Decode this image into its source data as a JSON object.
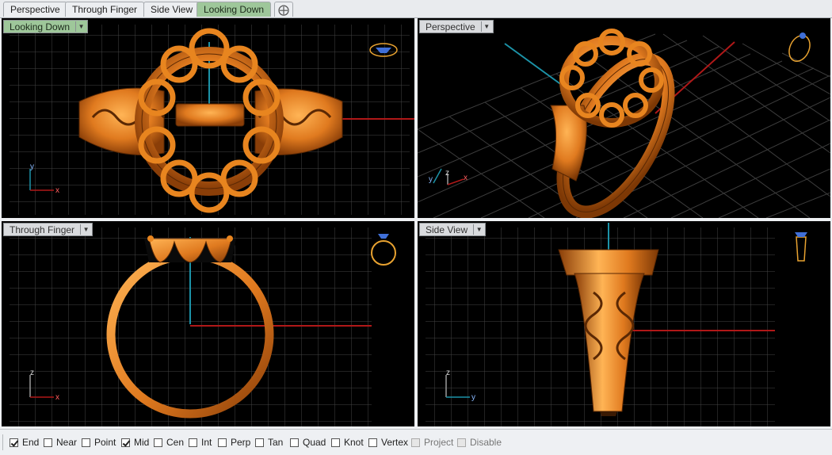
{
  "tabs": [
    {
      "label": "Perspective",
      "active": false
    },
    {
      "label": "Through Finger",
      "active": false
    },
    {
      "label": "Side View",
      "active": false
    },
    {
      "label": "Looking Down",
      "active": true
    }
  ],
  "viewports": {
    "looking_down": {
      "label": "Looking Down",
      "active": true
    },
    "perspective": {
      "label": "Perspective",
      "active": false
    },
    "through_finger": {
      "label": "Through Finger",
      "active": false
    },
    "side_view": {
      "label": "Side View",
      "active": false
    }
  },
  "axes": {
    "x": "x",
    "y": "y",
    "z": "z"
  },
  "osnaps": [
    {
      "label": "End",
      "checked": true,
      "enabled": true
    },
    {
      "label": "Near",
      "checked": false,
      "enabled": true
    },
    {
      "label": "Point",
      "checked": false,
      "enabled": true
    },
    {
      "label": "Mid",
      "checked": true,
      "enabled": true
    },
    {
      "label": "Cen",
      "checked": false,
      "enabled": true
    },
    {
      "label": "Int",
      "checked": false,
      "enabled": true
    },
    {
      "label": "Perp",
      "checked": false,
      "enabled": true
    },
    {
      "label": "Tan",
      "checked": false,
      "enabled": true
    },
    {
      "label": "Quad",
      "checked": false,
      "enabled": true
    },
    {
      "label": "Knot",
      "checked": false,
      "enabled": true
    },
    {
      "label": "Vertex",
      "checked": false,
      "enabled": true
    },
    {
      "label": "Project",
      "checked": false,
      "enabled": false
    },
    {
      "label": "Disable",
      "checked": false,
      "enabled": false
    }
  ],
  "colors": {
    "viewport_bg": "#000000",
    "grid": "#4a4a4a",
    "x_axis": "#b01818",
    "y_axis": "#1c93a8",
    "gold": "#e07a1f",
    "active_tab": "#9ec79a"
  }
}
